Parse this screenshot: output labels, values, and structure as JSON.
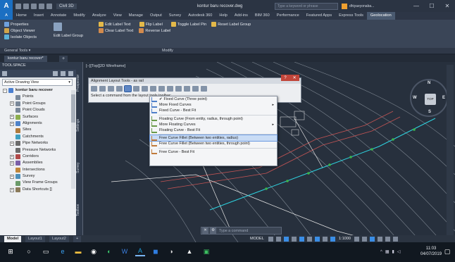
{
  "window": {
    "title": "kontur baru recover.dwg",
    "workspace": "Civil 3D",
    "search_placeholder": "Type a keyword or phrase",
    "user": "dhiyaeyonaba...",
    "controls": [
      "—",
      "☐",
      "✕"
    ]
  },
  "ribbon": {
    "tabs": [
      "Home",
      "Insert",
      "Annotate",
      "Modify",
      "Analyze",
      "View",
      "Manage",
      "Output",
      "Survey",
      "Autodesk 360",
      "Help",
      "Add-ins",
      "BIM 360",
      "Performance",
      "Featured Apps",
      "Express Tools",
      "Geolocation"
    ],
    "active_tab": "Geolocation",
    "left_group": [
      "Properties",
      "Object Viewer",
      "Isolate Objects"
    ],
    "edit_label_group": "Edit Label Group",
    "label_tools": [
      "Edit Label Text",
      "Flip Label",
      "Toggle Label Pin",
      "Reset Label Group",
      "Clear Label Text",
      "Reverse Label"
    ],
    "footer_left": "General Tools ▾",
    "footer_modify": "Modify"
  },
  "doc_tab": "kontur baru recover*",
  "toolspace": {
    "title": "TOOLSPACE",
    "view_selector": "Active Drawing View",
    "tree": [
      {
        "label": "kontur baru recover",
        "bold": true,
        "exp": "−",
        "color": "#4a7fd0"
      },
      {
        "label": "Points",
        "color": "#7a8899"
      },
      {
        "label": "Point Groups",
        "exp": "+",
        "color": "#7a8899"
      },
      {
        "label": "Point Clouds",
        "color": "#7a8899"
      },
      {
        "label": "Surfaces",
        "exp": "+",
        "color": "#8cae4f"
      },
      {
        "label": "Alignments",
        "exp": "+",
        "color": "#4e82c9"
      },
      {
        "label": "Sites",
        "color": "#b07a3c"
      },
      {
        "label": "Catchments",
        "color": "#3f9fc0"
      },
      {
        "label": "Pipe Networks",
        "exp": "+",
        "color": "#6c6c6c"
      },
      {
        "label": "Pressure Networks",
        "color": "#6c6c6c"
      },
      {
        "label": "Corridors",
        "exp": "+",
        "color": "#b04a4a"
      },
      {
        "label": "Assemblies",
        "exp": "+",
        "color": "#7a5fa8"
      },
      {
        "label": "Intersections",
        "color": "#c0863a"
      },
      {
        "label": "Survey",
        "exp": "+",
        "color": "#4d8fb8"
      },
      {
        "label": "View Frame Groups",
        "color": "#6a9a6a"
      },
      {
        "label": "Data Shortcuts []",
        "exp": "+",
        "color": "#8a7a5a"
      }
    ],
    "side_tabs": [
      "Prospector",
      "Settings",
      "Survey",
      "Toolbox"
    ]
  },
  "viewport_label": "[−][Top][2D Wireframe]",
  "layout_toolbar": {
    "title": "Alignment Layout Tools - as rail",
    "prompt": "Select a command from the layout tools toolbar:"
  },
  "menu": {
    "items": [
      {
        "label": "Fixed Curve (Three point)",
        "check": true
      },
      {
        "label": "More Fixed Curves",
        "submenu": true
      },
      {
        "label": "Fixed Curve - Best Fit"
      },
      {
        "sep": true
      },
      {
        "label": "Floating Curve (From entity, radius, through point)"
      },
      {
        "label": "More Floating Curves",
        "submenu": true
      },
      {
        "label": "Floating Curve - Best Fit"
      },
      {
        "sep": true
      },
      {
        "label": "Free Curve Fillet (Between two entities, radius)",
        "highlight": true
      },
      {
        "label": "Free Curve Fillet (Between two entities, through point)"
      },
      {
        "sep": true
      },
      {
        "label": "Free Curve - Best Fit"
      }
    ]
  },
  "compass": {
    "n": "N",
    "s": "S",
    "e": "E",
    "w": "W",
    "top": "TOP"
  },
  "command_line": {
    "placeholder": "Type a command"
  },
  "layouts": {
    "model": "Model",
    "layout1": "Layout1",
    "layout2": "Layout2"
  },
  "status": {
    "model_label": "MODEL",
    "scale": "1:1000"
  },
  "clock": {
    "time": "11:03",
    "date": "04/07/2019"
  },
  "colors": {
    "accent": "#1b6fc2",
    "highlight": "#c9dcf5",
    "canvas": "#27303d"
  }
}
